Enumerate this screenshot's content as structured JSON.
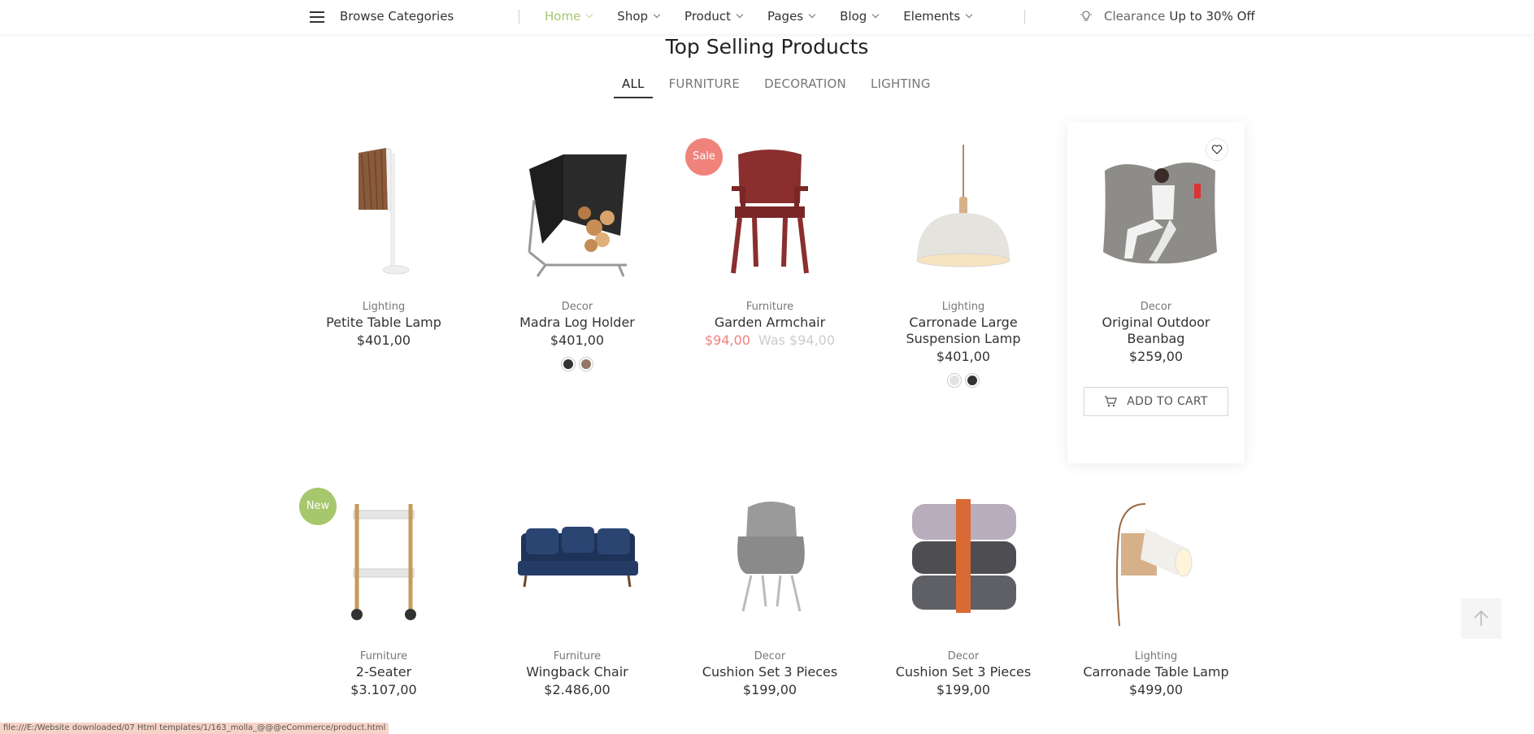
{
  "nav": {
    "browse_label": "Browse Categories",
    "menu": [
      {
        "label": "Home",
        "active": true
      },
      {
        "label": "Shop"
      },
      {
        "label": "Product"
      },
      {
        "label": "Pages"
      },
      {
        "label": "Blog"
      },
      {
        "label": "Elements"
      }
    ],
    "clearance_label": "Clearance",
    "clearance_offer": "Up to 30% Off"
  },
  "section": {
    "title": "Top Selling Products",
    "tabs": [
      "ALL",
      "FURNITURE",
      "DECORATION",
      "LIGHTING"
    ],
    "active_tab": "ALL"
  },
  "products": [
    {
      "category": "Lighting",
      "name": "Petite Table Lamp",
      "price": "$401,00",
      "icon": "table-lamp-icon"
    },
    {
      "category": "Decor",
      "name": "Madra Log Holder",
      "price": "$401,00",
      "swatches": [
        "#333333",
        "#927764"
      ],
      "icon": "log-holder-icon"
    },
    {
      "category": "Furniture",
      "name": "Garden Armchair",
      "sale_price": "$94,00",
      "was_price": "Was $94,00",
      "badge": "Sale",
      "icon": "armchair-icon"
    },
    {
      "category": "Lighting",
      "name": "Carronade Large Suspension Lamp",
      "price": "$401,00",
      "swatches": [
        "#e2e2e2",
        "#333333"
      ],
      "icon": "pendant-lamp-icon"
    },
    {
      "category": "Decor",
      "name": "Original Outdoor Beanbag",
      "price": "$259,00",
      "add_to_cart": "ADD TO CART",
      "icon": "beanbag-icon"
    },
    {
      "category": "Furniture",
      "name": "2-Seater",
      "price": "$3.107,00",
      "badge": "New",
      "icon": "trolley-icon"
    },
    {
      "category": "Furniture",
      "name": "Wingback Chair",
      "price": "$2.486,00",
      "icon": "sofa-icon"
    },
    {
      "category": "Decor",
      "name": "Cushion Set 3 Pieces",
      "price": "$199,00",
      "icon": "lounge-chair-icon"
    },
    {
      "category": "Decor",
      "name": "Cushion Set 3 Pieces",
      "price": "$199,00",
      "icon": "cushion-stack-icon"
    },
    {
      "category": "Lighting",
      "name": "Carronade Table Lamp",
      "price": "$499,00",
      "icon": "wall-lamp-icon"
    }
  ],
  "colors": {
    "accent": "#a6c76c",
    "sale": "#ef837b"
  },
  "status_url": "file:///E:/Website downloaded/07 Html templates/1/163_molla_@@@eCommerce/product.html"
}
